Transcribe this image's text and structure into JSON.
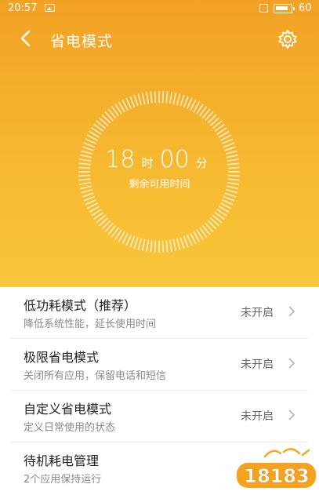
{
  "status_bar": {
    "time": "20:57",
    "battery": "60"
  },
  "header": {
    "title": "省电模式"
  },
  "dial": {
    "hours": "18",
    "hours_unit": "时",
    "minutes": "00",
    "minutes_unit": "分",
    "caption": "剩余可用时间"
  },
  "items": [
    {
      "title": "低功耗模式（推荐）",
      "desc": "降低系统性能，延长使用时间",
      "status": "未开启"
    },
    {
      "title": "极限省电模式",
      "desc": "关闭所有应用，保留电话和短信",
      "status": "未开启"
    },
    {
      "title": "自定义省电模式",
      "desc": "定义日常使用的状态",
      "status": "未开启"
    },
    {
      "title": "待机耗电管理",
      "desc": "2个应用保持运行",
      "status": ""
    }
  ],
  "watermark": {
    "text": "18183"
  },
  "colors": {
    "accent": "#f6b02c",
    "accent_dark": "#f2a124"
  }
}
